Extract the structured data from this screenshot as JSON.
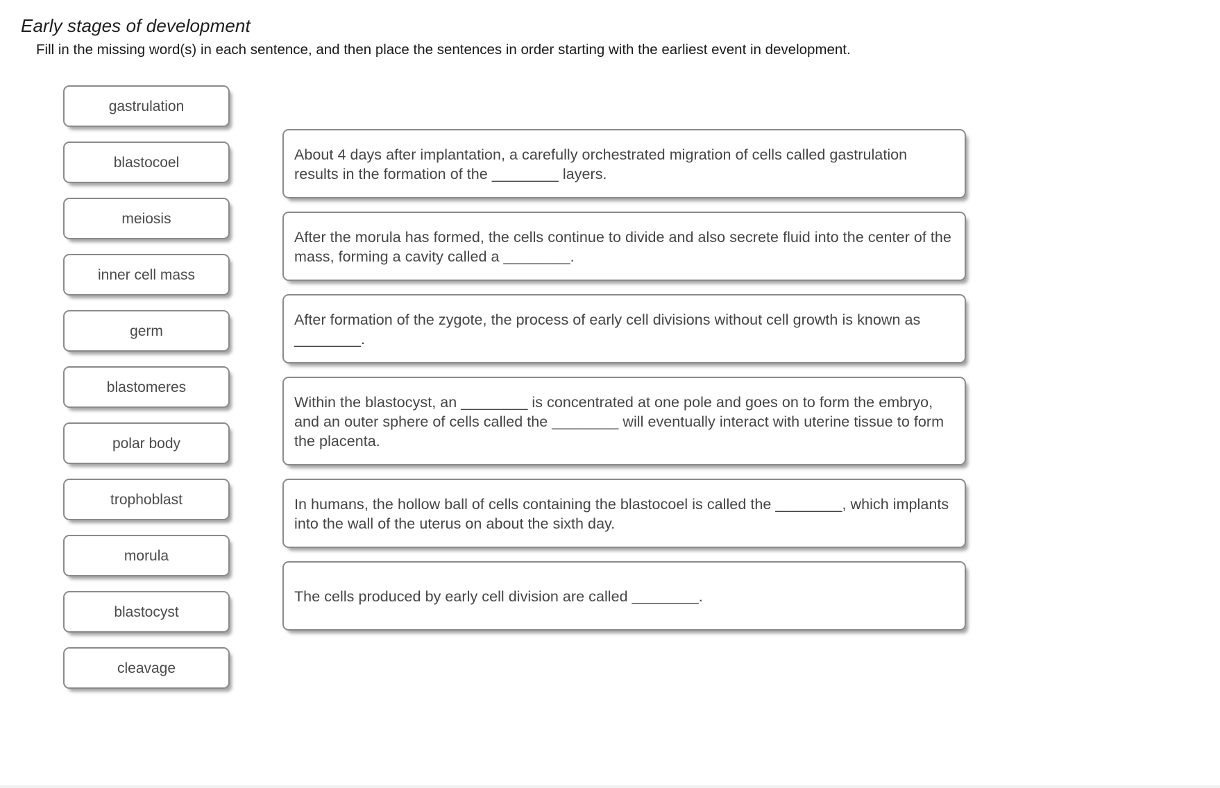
{
  "header": {
    "title": "Early stages of development",
    "instruction": "Fill in the missing word(s) in each sentence, and then place the sentences in order starting with the earliest event in development."
  },
  "word_bank": {
    "items": [
      {
        "label": "gastrulation"
      },
      {
        "label": "blastocoel"
      },
      {
        "label": "meiosis"
      },
      {
        "label": "inner cell mass"
      },
      {
        "label": "germ"
      },
      {
        "label": "blastomeres"
      },
      {
        "label": "polar body"
      },
      {
        "label": "trophoblast"
      },
      {
        "label": "morula"
      },
      {
        "label": "blastocyst"
      },
      {
        "label": "cleavage"
      }
    ]
  },
  "sentences": {
    "items": [
      {
        "text": "About 4 days after implantation, a carefully orchestrated migration of cells called gastrulation results in the formation of the ________ layers.",
        "lines": 2
      },
      {
        "text": "After the morula has formed, the cells continue to divide and also secrete fluid into the center of the mass, forming a cavity called a ________.",
        "lines": 2
      },
      {
        "text": "After formation of the zygote, the process of early cell divisions without cell growth is known as ________.",
        "lines": 2
      },
      {
        "text": "Within the blastocyst, an ________ is concentrated at one pole and goes on to form the embryo, and an outer sphere of cells called the ________ will eventually interact with uterine tissue to form the placenta.",
        "lines": 3
      },
      {
        "text": "In humans, the hollow ball of cells containing the blastocoel is called the ________, which implants into the wall of the uterus on about the sixth day.",
        "lines": 2
      },
      {
        "text": "The cells produced by early cell division are called ________.",
        "lines": 2
      }
    ]
  },
  "colors": {
    "card_border": "#8a8a8a",
    "card_background": "#ffffff",
    "text": "#444444",
    "page_background": "#ffffff"
  }
}
